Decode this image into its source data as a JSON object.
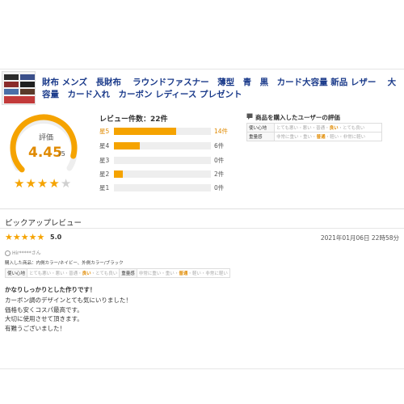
{
  "product": {
    "title": "財布 メンズ　長財布　 ラウンドファスナー　薄型　青　黒　カード大容量 新品 レザー　 大容量　カード入れ　カーボン レディース プレゼント"
  },
  "rating": {
    "label": "評価",
    "value": "4.45",
    "suffix": "/5",
    "stars_filled": 4,
    "stars_total": 5
  },
  "distribution": {
    "count_label": "レビュー件数：22件",
    "rows": [
      {
        "label": "星5",
        "count": "14件",
        "fraction": 0.64
      },
      {
        "label": "星4",
        "count": "6件",
        "fraction": 0.27
      },
      {
        "label": "星3",
        "count": "0件",
        "fraction": 0.0
      },
      {
        "label": "星2",
        "count": "2件",
        "fraction": 0.09
      },
      {
        "label": "星1",
        "count": "0件",
        "fraction": 0.0
      }
    ]
  },
  "user_eval": {
    "heading": "商品を購入したユーザーの評価",
    "rows": [
      {
        "key": "使い心地",
        "options": [
          "とても悪い",
          "悪い",
          "普通",
          "良い",
          "とても良い"
        ],
        "selected": 3
      },
      {
        "key": "重量感",
        "options": [
          "非常に重い",
          "重い",
          "普通",
          "軽い",
          "非常に軽い"
        ],
        "selected": 2
      }
    ]
  },
  "pickup": {
    "title": "ピックアップレビュー",
    "stars": "★★★★★",
    "score": "5.0",
    "date": "2021年01月06日 22時58分",
    "user": "Hir*****さん",
    "product_variant": "購入した商品：内側カラー/ネイビー、外側カラー/ブラック",
    "eval": [
      {
        "key": "使い心地",
        "options": [
          "とても悪い",
          "悪い",
          "普通",
          "良い",
          "とても良い"
        ],
        "selected": 3
      },
      {
        "key": "重量感",
        "options": [
          "非常に重い",
          "重い",
          "普通",
          "軽い",
          "非常に軽い"
        ],
        "selected": 2
      }
    ],
    "headline": "かなりしっかりとした作りです！",
    "body": [
      "カーボン調のデザインとても気にいりました！",
      "価格も安くコスパ最高です。",
      "大切に使用させて頂きます。",
      "有難うございました！"
    ]
  },
  "colors": {
    "accent": "#f5a300",
    "link": "#1a3a8a"
  }
}
